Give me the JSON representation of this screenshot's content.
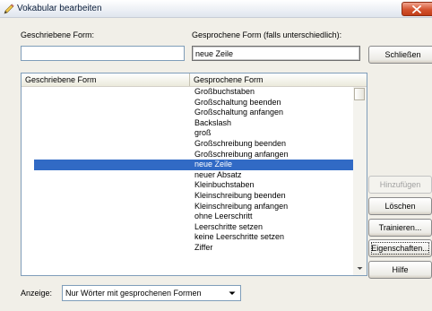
{
  "window": {
    "title": "Vokabular bearbeiten",
    "icon": "pencil-icon",
    "close_icon": "close-icon",
    "close_color": "#d4532f"
  },
  "form": {
    "written_label": "Geschriebene Form:",
    "written_value": "",
    "spoken_label": "Gesprochene Form (falls unterschiedlich):",
    "spoken_value": "neue Zeile"
  },
  "buttons": {
    "close": "Schließen",
    "add": "Hinzufügen",
    "delete": "Löschen",
    "train": "Trainieren...",
    "properties": "Eigenschaften...",
    "help": "Hilfe"
  },
  "list": {
    "columns": [
      "Geschriebene Form",
      "Gesprochene Form"
    ],
    "selected_index": 7,
    "selection_color": "#316ac5",
    "rows": [
      {
        "written": "",
        "spoken": "Großbuchstaben"
      },
      {
        "written": "",
        "spoken": "Großschaltung beenden"
      },
      {
        "written": "",
        "spoken": "Großschaltung anfangen"
      },
      {
        "written": "",
        "spoken": "Backslash"
      },
      {
        "written": "",
        "spoken": "groß"
      },
      {
        "written": "",
        "spoken": "Großschreibung beenden"
      },
      {
        "written": "",
        "spoken": "Großschreibung anfangen"
      },
      {
        "written": "",
        "spoken": "neue Zeile"
      },
      {
        "written": "",
        "spoken": "neuer Absatz"
      },
      {
        "written": "",
        "spoken": "Kleinbuchstaben"
      },
      {
        "written": "",
        "spoken": "Kleinschreibung beenden"
      },
      {
        "written": "",
        "spoken": "Kleinschreibung anfangen"
      },
      {
        "written": "",
        "spoken": "ohne Leerschritt"
      },
      {
        "written": "",
        "spoken": "Leerschritte setzen"
      },
      {
        "written": "",
        "spoken": "keine Leerschritte setzen"
      },
      {
        "written": "",
        "spoken": "Ziffer"
      }
    ]
  },
  "display": {
    "label": "Anzeige:",
    "selected": "Nur Wörter mit gesprochenen Formen"
  }
}
